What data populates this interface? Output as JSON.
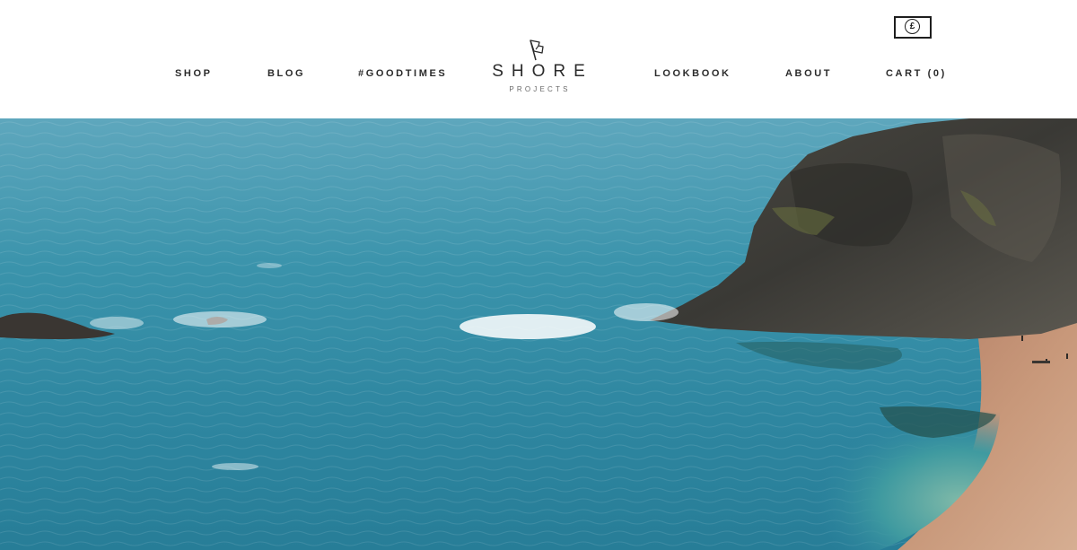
{
  "nav": {
    "left": [
      {
        "label": "SHOP"
      },
      {
        "label": "BLOG"
      },
      {
        "label": "#GOODTIMES"
      }
    ],
    "right": [
      {
        "label": "LOOKBOOK"
      },
      {
        "label": "ABOUT"
      },
      {
        "label": "CART (0)"
      }
    ]
  },
  "logo": {
    "title": "SHORE",
    "subtitle": "PROJECTS",
    "icon": "flag-icon"
  },
  "currency": {
    "symbol": "£",
    "icon": "currency-pound-icon"
  },
  "hero": {
    "scene": "coastal-cliff-sea-photo",
    "colors": {
      "sea": "#2f8aa0",
      "cliff": "#3b3a36",
      "sand": "#c89676"
    }
  }
}
